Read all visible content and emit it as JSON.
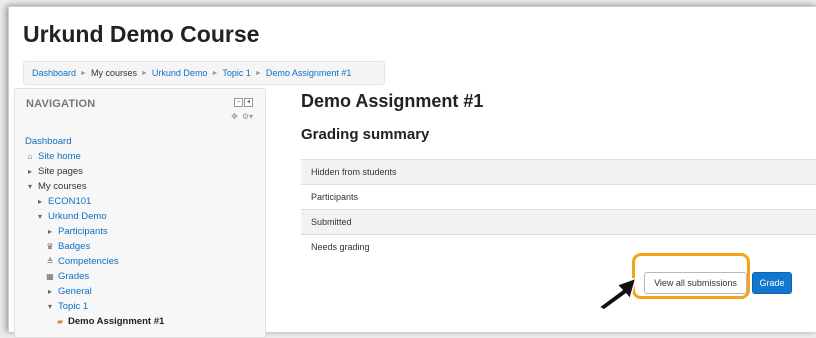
{
  "course": {
    "title": "Urkund Demo Course"
  },
  "breadcrumb": [
    "Dashboard",
    "My courses",
    "Urkund Demo",
    "Topic 1",
    "Demo Assignment #1"
  ],
  "navigation": {
    "heading": "NAVIGATION",
    "items": [
      {
        "label": "Dashboard",
        "icon": ""
      },
      {
        "label": "Site home",
        "icon": "home-icon"
      },
      {
        "label": "Site pages",
        "icon": "collapsed-arrow-icon"
      },
      {
        "label": "My courses",
        "icon": "expanded-arrow-icon"
      },
      {
        "label": "ECON101",
        "icon": "collapsed-arrow-icon"
      },
      {
        "label": "Urkund Demo",
        "icon": "expanded-arrow-icon"
      },
      {
        "label": "Participants",
        "icon": "collapsed-arrow-icon"
      },
      {
        "label": "Badges",
        "icon": "trophy-icon"
      },
      {
        "label": "Competencies",
        "icon": "scale-icon"
      },
      {
        "label": "Grades",
        "icon": "grades-table-icon"
      },
      {
        "label": "General",
        "icon": "collapsed-arrow-icon"
      },
      {
        "label": "Topic 1",
        "icon": "expanded-arrow-icon"
      },
      {
        "label": "Demo Assignment #1",
        "icon": "assignment-icon"
      }
    ]
  },
  "main": {
    "title": "Demo Assignment #1",
    "section_heading": "Grading summary",
    "summary_rows": [
      "Hidden from students",
      "Participants",
      "Submitted",
      "Needs grading"
    ]
  },
  "actions": {
    "view_all": "View all submissions",
    "grade": "Grade"
  },
  "colors": {
    "link": "#0f6fc5",
    "grade_button": "#1177d1",
    "highlight": "#f0a616"
  }
}
